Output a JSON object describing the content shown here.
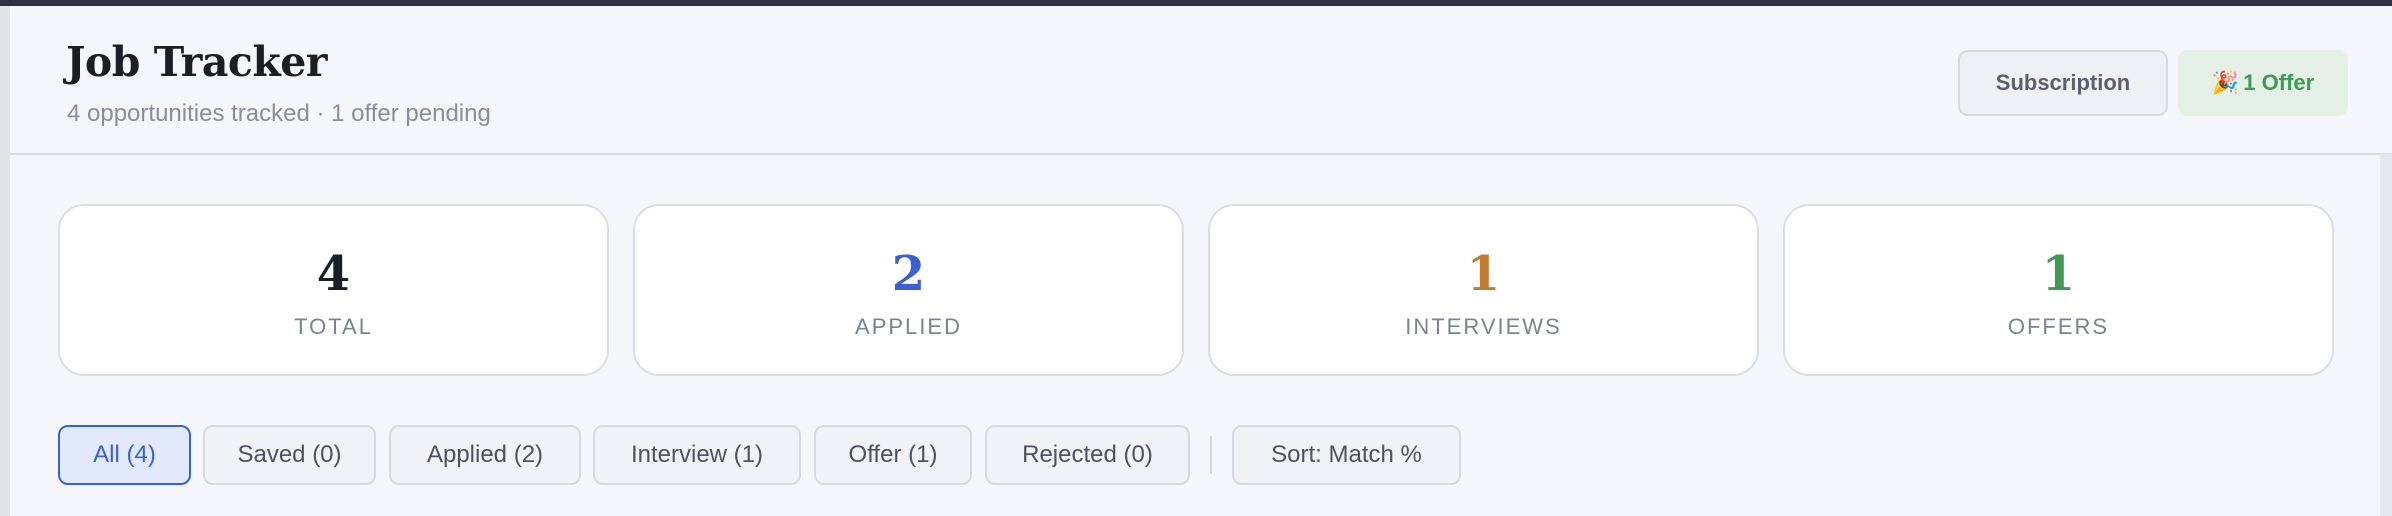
{
  "header": {
    "title": "Job Tracker",
    "subtitle": "4 opportunities tracked · 1 offer pending",
    "subscription_label": "Subscription",
    "offer_badge_icon": "party-popper-icon",
    "offer_badge_emoji": "🎉",
    "offer_badge_label": "1 Offer"
  },
  "stats": [
    {
      "value": "4",
      "label": "TOTAL",
      "color": "#1c1e26"
    },
    {
      "value": "2",
      "label": "APPLIED",
      "color": "#3a5fd6"
    },
    {
      "value": "1",
      "label": "INTERVIEWS",
      "color": "#c27a2c"
    },
    {
      "value": "1",
      "label": "OFFERS",
      "color": "#3f9a55"
    }
  ],
  "filters": [
    {
      "label": "All (4)",
      "active": true
    },
    {
      "label": "Saved (0)",
      "active": false
    },
    {
      "label": "Applied (2)",
      "active": false
    },
    {
      "label": "Interview (1)",
      "active": false
    },
    {
      "label": "Offer (1)",
      "active": false
    },
    {
      "label": "Rejected (0)",
      "active": false
    }
  ],
  "sort": {
    "label": "Sort: Match %"
  },
  "colors": {
    "accent": "#3a5fd6",
    "success": "#3f9a55",
    "warning": "#c27a2c"
  }
}
